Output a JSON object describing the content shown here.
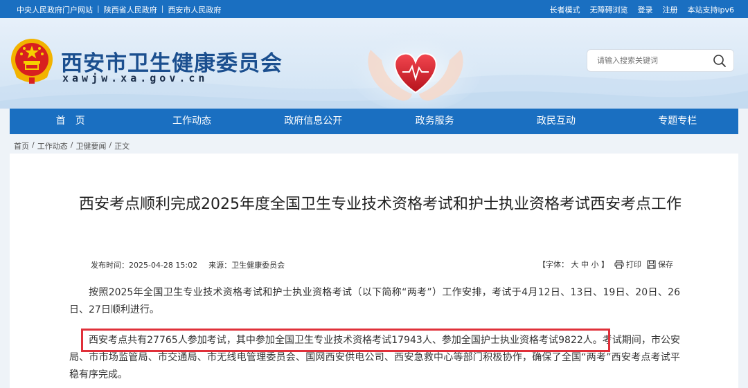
{
  "topbar": {
    "left_links": [
      "中央人民政府门户网站",
      "陕西省人民政府",
      "西安市人民政府"
    ],
    "right_links": [
      "长者模式",
      "无障碍浏览",
      "登录",
      "注册",
      "本站支持ipv6"
    ]
  },
  "header": {
    "title": "西安市卫生健康委员会",
    "domain": "xawjw.xa.gov.cn"
  },
  "search": {
    "placeholder": "请输入搜索关键词"
  },
  "nav": {
    "items": [
      "首　页",
      "工作动态",
      "政府信息公开",
      "政务服务",
      "政民互动",
      "专题专栏"
    ]
  },
  "breadcrumb": {
    "items": [
      "首页",
      "工作动态",
      "卫健要闻",
      "正文"
    ]
  },
  "article": {
    "title": "西安考点顺利完成2025年度全国卫生专业技术资格考试和护士执业资格考试西安考点工作",
    "publish_label": "发布时间：",
    "publish_time": "2025-04-28 15:02",
    "source_label": "来源：",
    "source": "卫生健康委员会",
    "font_label": "【字体：",
    "font_sizes": [
      "大",
      "中",
      "小"
    ],
    "font_end": "】",
    "print_label": "打印",
    "save_label": "保存",
    "paragraph1": "按照2025年全国卫生专业技术资格考试和护士执业资格考试（以下简称“两考”）工作安排，考试于4月12日、13日、19日、20日、26日、27日顺利进行。",
    "paragraph2": "西安考点共有27765人参加考试，其中参加全国卫生专业技术资格考试17943人、参加全国护士执业资格考试9822人。考试期间，市公安局、市市场监管局、市交通局、市无线电管理委员会、国网西安供电公司、西安急救中心等部门积极协作，确保了全国“两考”西安考点考试平稳有序完成。"
  },
  "colors": {
    "primary": "#1a6fc1",
    "title_blue": "#1b4f8f",
    "highlight": "#e0303a",
    "heart_red": "#d81e2c"
  }
}
